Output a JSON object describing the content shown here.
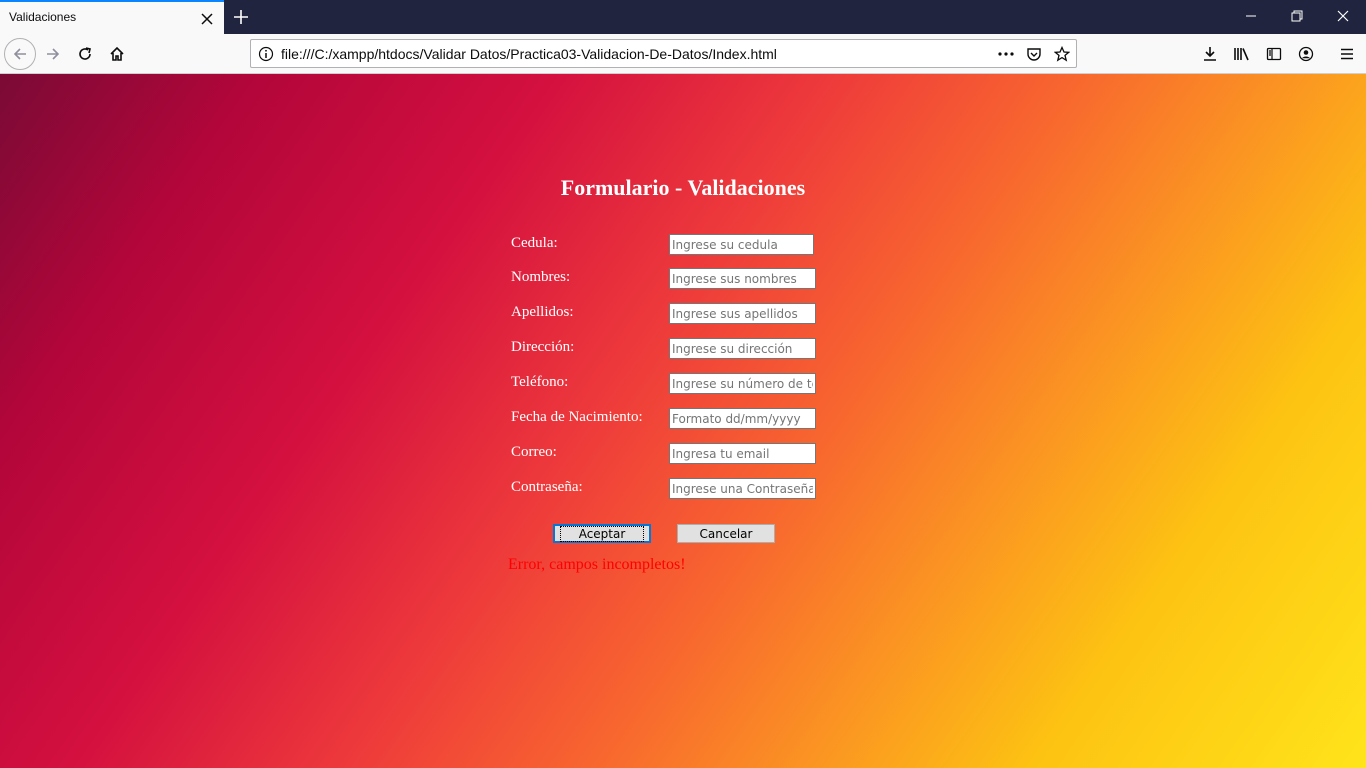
{
  "browser": {
    "tab_title": "Validaciones",
    "url": "file:///C:/xampp/htdocs/Validar Datos/Practica03-Validacion-De-Datos/Index.html"
  },
  "page": {
    "title": "Formulario - Validaciones",
    "fields": [
      {
        "label": "Cedula:",
        "placeholder": "Ingrese su cedula"
      },
      {
        "label": "Nombres:",
        "placeholder": "Ingrese sus nombres"
      },
      {
        "label": "Apellidos:",
        "placeholder": "Ingrese sus apellidos"
      },
      {
        "label": "Dirección:",
        "placeholder": "Ingrese su dirección"
      },
      {
        "label": "Teléfono:",
        "placeholder": "Ingrese su número de telefono"
      },
      {
        "label": "Fecha de Nacimiento:",
        "placeholder": "Formato dd/mm/yyyy"
      },
      {
        "label": "Correo:",
        "placeholder": "Ingresa tu email"
      },
      {
        "label": "Contraseña:",
        "placeholder": "Ingrese una Contraseña"
      }
    ],
    "accept_label": "Aceptar",
    "cancel_label": "Cancelar",
    "error_message": "Error, campos incompletos!"
  },
  "icons": {
    "tab_close": "close-icon",
    "new_tab": "plus-icon",
    "back": "back-arrow-icon",
    "forward": "forward-arrow-icon",
    "reload": "reload-icon",
    "home": "home-icon",
    "site_info": "info-icon",
    "page_actions": "more-dots-icon",
    "pocket": "pocket-icon",
    "bookmark": "star-icon",
    "downloads": "download-icon",
    "library": "library-icon",
    "sidebar": "sidebar-icon",
    "account": "account-icon",
    "menu": "hamburger-menu-icon"
  },
  "colors": {
    "tabbar": "#20243e",
    "active_tab_accent": "#0a84ff",
    "error_text": "#ff0000",
    "title_text": "#ffffff"
  }
}
